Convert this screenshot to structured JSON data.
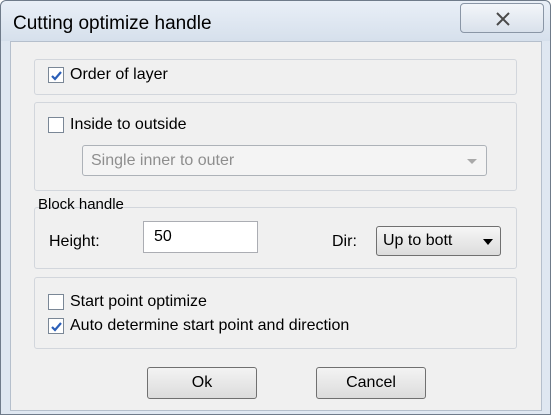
{
  "window": {
    "title": "Cutting optimize handle"
  },
  "order_of_layer": {
    "label": "Order of layer",
    "checked": true
  },
  "inside_to_outside": {
    "label": "Inside to outside",
    "checked": false,
    "mode_value": "Single inner to outer"
  },
  "block_handle": {
    "title": "Block handle",
    "height_label": "Height:",
    "height_value": "50",
    "dir_label": "Dir:",
    "dir_value": "Up to bott"
  },
  "start_point": {
    "optimize_label": "Start point optimize",
    "optimize_checked": false,
    "auto_label": "Auto determine start point and direction",
    "auto_checked": true
  },
  "buttons": {
    "ok": "Ok",
    "cancel": "Cancel"
  }
}
